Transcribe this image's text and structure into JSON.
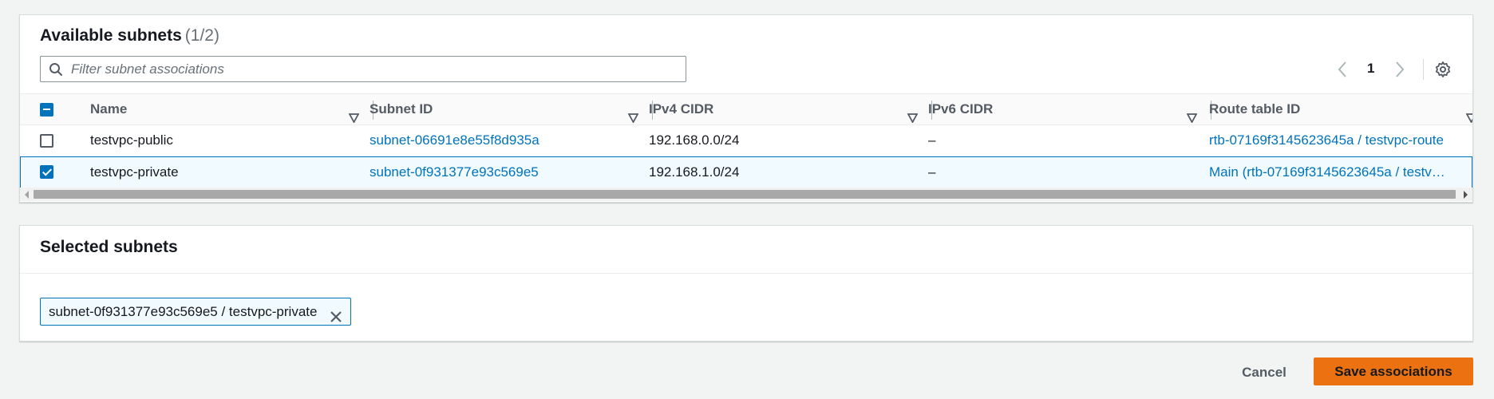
{
  "available": {
    "title": "Available subnets",
    "count": "(1/2)",
    "filter_placeholder": "Filter subnet associations",
    "page": "1",
    "columns": [
      "Name",
      "Subnet ID",
      "IPv4 CIDR",
      "IPv6 CIDR",
      "Route table ID"
    ],
    "rows": [
      {
        "checked": false,
        "name": "testvpc-public",
        "subnet_id": "subnet-06691e8e55f8d935a",
        "ipv4": "192.168.0.0/24",
        "ipv6": "–",
        "route_table": "rtb-07169f3145623645a / testvpc-route"
      },
      {
        "checked": true,
        "name": "testvpc-private",
        "subnet_id": "subnet-0f931377e93c569e5",
        "ipv4": "192.168.1.0/24",
        "ipv6": "–",
        "route_table": "Main (rtb-07169f3145623645a / testv…"
      }
    ]
  },
  "selected": {
    "title": "Selected subnets",
    "tokens": [
      "subnet-0f931377e93c569e5 / testvpc-private"
    ]
  },
  "actions": {
    "cancel": "Cancel",
    "save": "Save associations"
  },
  "colors": {
    "link": "#0073bb",
    "primary_button": "#ec7211",
    "selected_row_bg": "#f1faff"
  }
}
